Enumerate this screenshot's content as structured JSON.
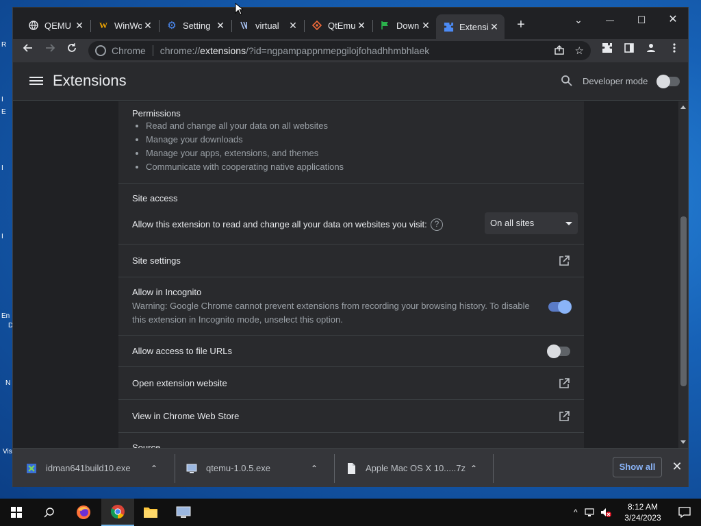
{
  "desktop": {
    "labels": [
      "R",
      "I",
      "E",
      "I",
      "I",
      "En",
      "D",
      "N",
      "Vis"
    ]
  },
  "tabs": [
    {
      "title": "QEMU",
      "icon": "globe-icon"
    },
    {
      "title": "WinWo",
      "icon": "w-logo-icon"
    },
    {
      "title": "Setting",
      "icon": "gear-icon"
    },
    {
      "title": "virtual",
      "icon": "virtual-icon"
    },
    {
      "title": "QtEmu",
      "icon": "qtemu-icon"
    },
    {
      "title": "Downl",
      "icon": "flag-icon"
    },
    {
      "title": "Extensi",
      "icon": "puzzle-icon"
    }
  ],
  "window_controls": {
    "minimize": "—",
    "maximize": "☐",
    "close": "✕",
    "tabsearch": "⌄"
  },
  "omnibox": {
    "label": "Chrome",
    "url_scheme": "chrome://",
    "url_host": "extensions",
    "url_rest": "/?id=ngpampappnmepgilojfohadhhmbhlaek"
  },
  "header": {
    "title": "Extensions",
    "developer_mode_label": "Developer mode",
    "developer_mode_on": false
  },
  "permissions": {
    "heading": "Permissions",
    "items": [
      "Read and change all your data on all websites",
      "Manage your downloads",
      "Manage your apps, extensions, and themes",
      "Communicate with cooperating native applications"
    ]
  },
  "site_access": {
    "heading": "Site access",
    "question": "Allow this extension to read and change all your data on websites you visit:",
    "help_glyph": "?",
    "selected": "On all sites"
  },
  "site_settings": {
    "label": "Site settings"
  },
  "incognito": {
    "label": "Allow in Incognito",
    "warning": "Warning: Google Chrome cannot prevent extensions from recording your browsing history. To disable this extension in Incognito mode, unselect this option.",
    "enabled": true
  },
  "file_urls": {
    "label": "Allow access to file URLs",
    "enabled": false
  },
  "open_website": {
    "label": "Open extension website"
  },
  "web_store": {
    "label": "View in Chrome Web Store"
  },
  "source": {
    "label": "Source"
  },
  "downloads": [
    {
      "name": "idman641build10.exe",
      "icon": "idm-file-icon"
    },
    {
      "name": "qtemu-1.0.5.exe",
      "icon": "exe-file-icon"
    },
    {
      "name": "Apple Mac OS X 10.....7z",
      "icon": "document-file-icon"
    }
  ],
  "download_bar": {
    "show_all": "Show all",
    "close": "✕"
  },
  "clock": {
    "time": "8:12 AM",
    "date": "3/24/2023"
  },
  "colors": {
    "accent": "#8ab4f8",
    "bg": "#202124",
    "card": "#292a2d"
  }
}
